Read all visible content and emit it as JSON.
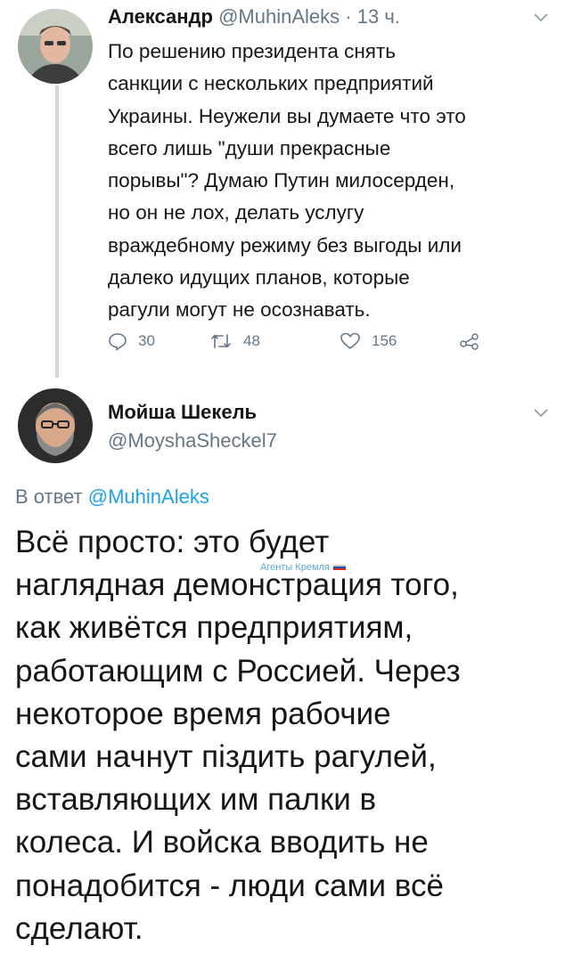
{
  "tweet1": {
    "author_name": "Александр",
    "author_handle": "@MuhinAleks",
    "separator": "·",
    "time": "13 ч.",
    "body_lines": [
      "По решению президента снять",
      "санкции с нескольких предприятий",
      "Украины. Неужели вы думаете что это",
      "всего лишь \"души прекрасные",
      "порывы\"? Думаю Путин милосерден,",
      "но он не лох, делать услугу",
      "враждебному режиму без выгоды или",
      "далеко идущих планов, которые",
      "рагули могут не осознавать."
    ],
    "replies": "30",
    "retweets": "48",
    "likes": "156"
  },
  "tweet2": {
    "author_name": "Мойша Шекель",
    "author_handle": "@MoyshaSheckel7",
    "reply_prefix": "В ответ",
    "reply_handle": "@MuhinAleks",
    "body_lines": [
      "Всё просто: это будет",
      "наглядная демонстрация того,",
      "как живётся предприятиям,",
      "работающим с Россией. Через",
      "некоторое время рабочие",
      "сами начнут піздить рагулей,",
      "вставляющих им палки в",
      "колеса. И войска вводить не",
      "понадобится - люди сами всё",
      "сделают."
    ]
  },
  "watermark": "Агенты Кремля",
  "icons": {
    "reply": "reply-icon",
    "retweet": "retweet-icon",
    "like": "heart-icon",
    "share": "share-icon",
    "menu": "chevron-down-icon"
  },
  "colors": {
    "text": "#14171a",
    "secondary": "#657786",
    "link": "#1da1f2",
    "thread_line": "#ccd6dd"
  }
}
